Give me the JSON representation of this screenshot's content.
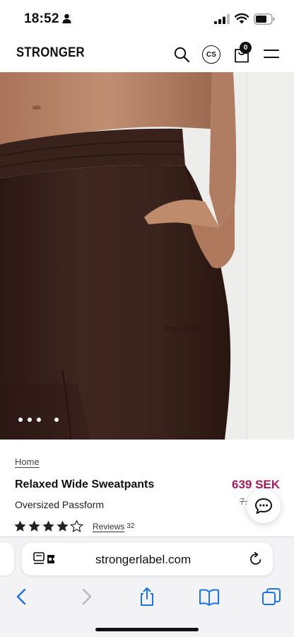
{
  "status_bar": {
    "time": "18:52",
    "icons": [
      "person-icon",
      "cellular-signal-icon",
      "wifi-icon",
      "battery-icon"
    ]
  },
  "header": {
    "logo": "STRONGER",
    "currency": "CS",
    "cart_count": "0",
    "icons": [
      "search-icon",
      "bag-icon",
      "menu-icon"
    ]
  },
  "gallery": {
    "slide_count": 4,
    "active_slide": 3
  },
  "product": {
    "breadcrumb": "Home",
    "title": "Relaxed Wide Sweatpants",
    "price": "639 SEK",
    "old_price": "7…",
    "subtitle": "Oversized Passform",
    "rating": 4.5,
    "reviews_label": "Reviews",
    "reviews_count": "32"
  },
  "browser": {
    "url": "strongerlabel.com",
    "icons": [
      "reader-mode-icon",
      "reload-icon",
      "back-icon",
      "forward-icon",
      "share-icon",
      "bookmarks-icon",
      "tabs-icon"
    ]
  },
  "colors": {
    "price": "#a31b5d",
    "fabric": "#3e2520",
    "skin": "#b78468"
  }
}
